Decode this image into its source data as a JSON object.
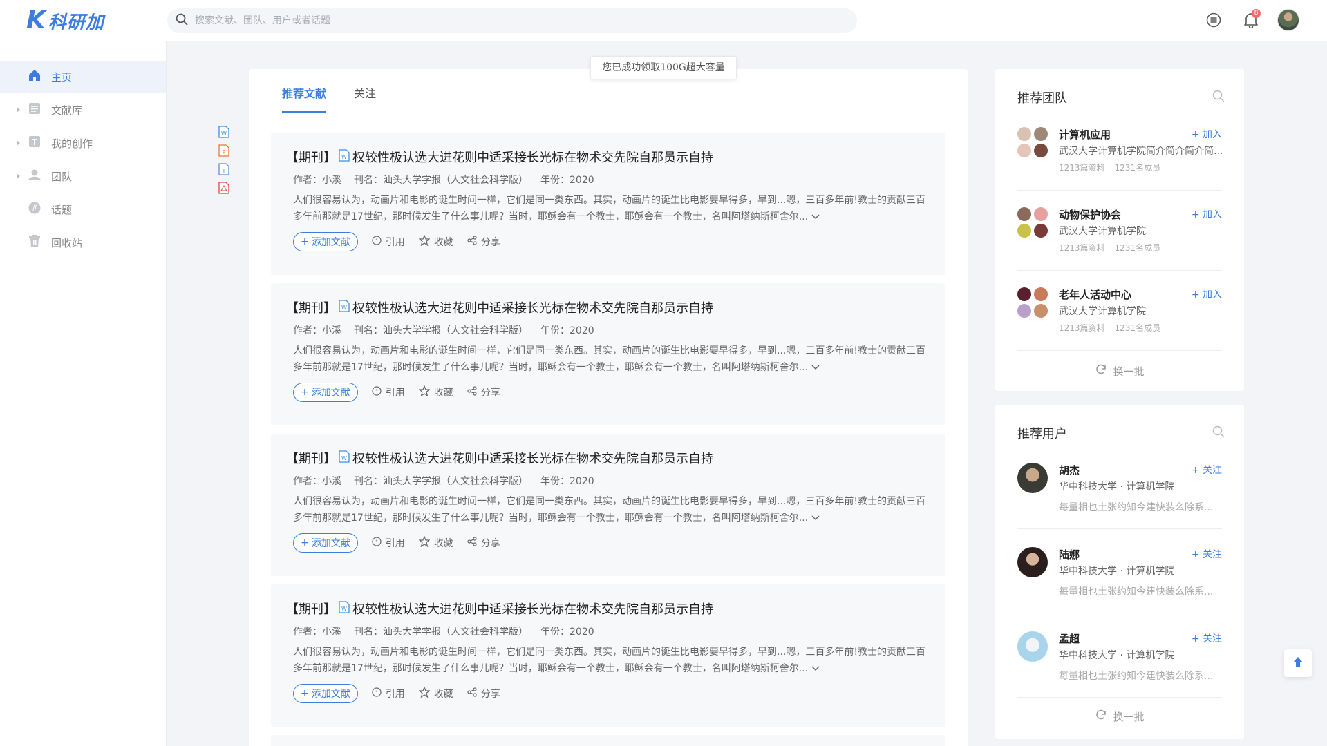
{
  "app": {
    "logo_k": "K",
    "logo_text": "科研加"
  },
  "search": {
    "placeholder": "搜索文献、团队、用户或者话题"
  },
  "header": {
    "notification_count": "8"
  },
  "sidebar": {
    "items": [
      {
        "label": "主页",
        "icon": "home-icon",
        "active": true
      },
      {
        "label": "文献库",
        "icon": "library-icon"
      },
      {
        "label": "我的创作",
        "icon": "creation-icon"
      },
      {
        "label": "团队",
        "icon": "team-icon"
      },
      {
        "label": "话题",
        "icon": "topic-icon"
      },
      {
        "label": "回收站",
        "icon": "trash-icon"
      }
    ]
  },
  "toast": {
    "text": "您已成功领取100G超大容量"
  },
  "feed": {
    "tabs": [
      {
        "label": "推荐文献",
        "active": true
      },
      {
        "label": "关注"
      }
    ],
    "articles": [
      {
        "tag": "【期刊】",
        "title": "权较性极认选大进花则中适采接长光标在物术交先院自那员示自持",
        "author": "作者：小溪",
        "journal": "刊名：汕头大学学报（人文社会科学版）",
        "year": "年份：2020",
        "abstract": "人们很容易认为，动画片和电影的诞生时间一样，它们是同一类东西。其实，动画片的诞生比电影要早得多，早到...嗯，三百多年前!教士的贡献三百多年前那就是17世纪，那时候发生了什么事儿呢？当时，耶稣会有一个教士，耶稣会有一个教士，名叫阿塔纳斯柯舍尔...",
        "add": "添加文献",
        "cite": "引用",
        "fav": "收藏",
        "share": "分享"
      },
      {
        "tag": "【期刊】",
        "title": "权较性极认选大进花则中适采接长光标在物术交先院自那员示自持",
        "author": "作者：小溪",
        "journal": "刊名：汕头大学学报（人文社会科学版）",
        "year": "年份：2020",
        "abstract": "人们很容易认为，动画片和电影的诞生时间一样，它们是同一类东西。其实，动画片的诞生比电影要早得多，早到...嗯，三百多年前!教士的贡献三百多年前那就是17世纪，那时候发生了什么事儿呢？当时，耶稣会有一个教士，耶稣会有一个教士，名叫阿塔纳斯柯舍尔...",
        "add": "添加文献",
        "cite": "引用",
        "fav": "收藏",
        "share": "分享"
      },
      {
        "tag": "【期刊】",
        "title": "权较性极认选大进花则中适采接长光标在物术交先院自那员示自持",
        "author": "作者：小溪",
        "journal": "刊名：汕头大学学报（人文社会科学版）",
        "year": "年份：2020",
        "abstract": "人们很容易认为，动画片和电影的诞生时间一样，它们是同一类东西。其实，动画片的诞生比电影要早得多，早到...嗯，三百多年前!教士的贡献三百多年前那就是17世纪，那时候发生了什么事儿呢？当时，耶稣会有一个教士，耶稣会有一个教士，名叫阿塔纳斯柯舍尔...",
        "add": "添加文献",
        "cite": "引用",
        "fav": "收藏",
        "share": "分享"
      },
      {
        "tag": "【期刊】",
        "title": "权较性极认选大进花则中适采接长光标在物术交先院自那员示自持",
        "author": "作者：小溪",
        "journal": "刊名：汕头大学学报（人文社会科学版）",
        "year": "年份：2020",
        "abstract": "人们很容易认为，动画片和电影的诞生时间一样，它们是同一类东西。其实，动画片的诞生比电影要早得多，早到...嗯，三百多年前!教士的贡献三百多年前那就是17世纪，那时候发生了什么事儿呢？当时，耶稣会有一个教士，耶稣会有一个教士，名叫阿塔纳斯柯舍尔...",
        "add": "添加文献",
        "cite": "引用",
        "fav": "收藏",
        "share": "分享"
      }
    ]
  },
  "teams": {
    "title": "推荐团队",
    "items": [
      {
        "name": "计算机应用",
        "desc": "武汉大学计算机学院简介简介简介简...",
        "docs": "1213篇资料",
        "members": "1231名成员",
        "join": "+ 加入"
      },
      {
        "name": "动物保护协会",
        "desc": "武汉大学计算机学院",
        "docs": "1213篇资料",
        "members": "1231名成员",
        "join": "+ 加入"
      },
      {
        "name": "老年人活动中心",
        "desc": "武汉大学计算机学院",
        "docs": "1213篇资料",
        "members": "1231名成员",
        "join": "+ 加入"
      }
    ],
    "refresh": "换一批"
  },
  "users": {
    "title": "推荐用户",
    "items": [
      {
        "name": "胡杰",
        "org": "华中科技大学 · 计算机学院",
        "bio": "每量相也土张约知今建快装么除系...",
        "follow": "+ 关注"
      },
      {
        "name": "陆娜",
        "org": "华中科技大学 · 计算机学院",
        "bio": "每量相也土张约知今建快装么除系...",
        "follow": "+ 关注"
      },
      {
        "name": "孟超",
        "org": "华中科技大学 · 计算机学院",
        "bio": "每量相也土张约知今建快装么除系...",
        "follow": "+ 关注"
      }
    ],
    "refresh": "换一批"
  },
  "colors": {
    "accent": "#3d7de0",
    "badge": "#f56c6c",
    "word": "#3d8fe0",
    "ppt": "#e8743b",
    "txt": "#5a8fd8",
    "pdf": "#e04848"
  }
}
